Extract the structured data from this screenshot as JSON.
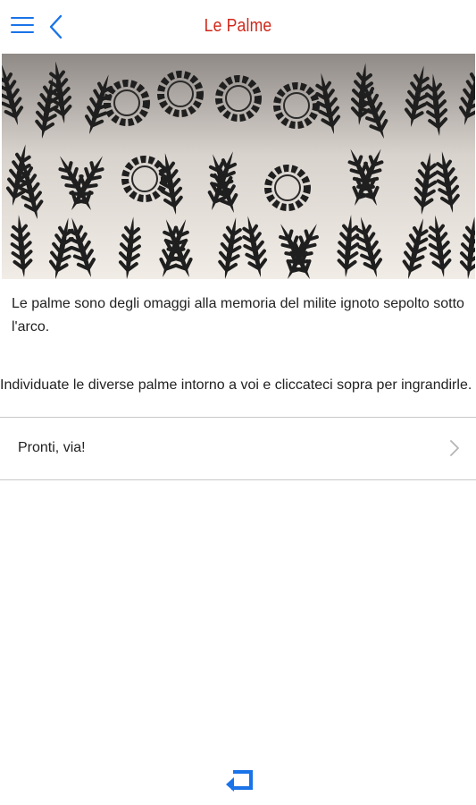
{
  "header": {
    "title": "Le Palme",
    "menu_icon": "hamburger-menu-icon",
    "back_icon": "chevron-left-icon",
    "accent_color": "#1a73e8",
    "title_color": "#d0281b"
  },
  "hero": {
    "image_subject": "black metal palm fronds and laurel wreaths on a light wall"
  },
  "content": {
    "intro": "Le palme sono degli omaggi alla memoria del milite ignoto sepolto sotto l'arco.",
    "instructions": "Individuate le diverse palme intorno a voi e cliccateci sopra per ingrandirle."
  },
  "cta": {
    "label": "Pronti, via!",
    "chevron_icon": "chevron-right-icon"
  },
  "footer": {
    "return_icon": "return-arrow-icon"
  }
}
